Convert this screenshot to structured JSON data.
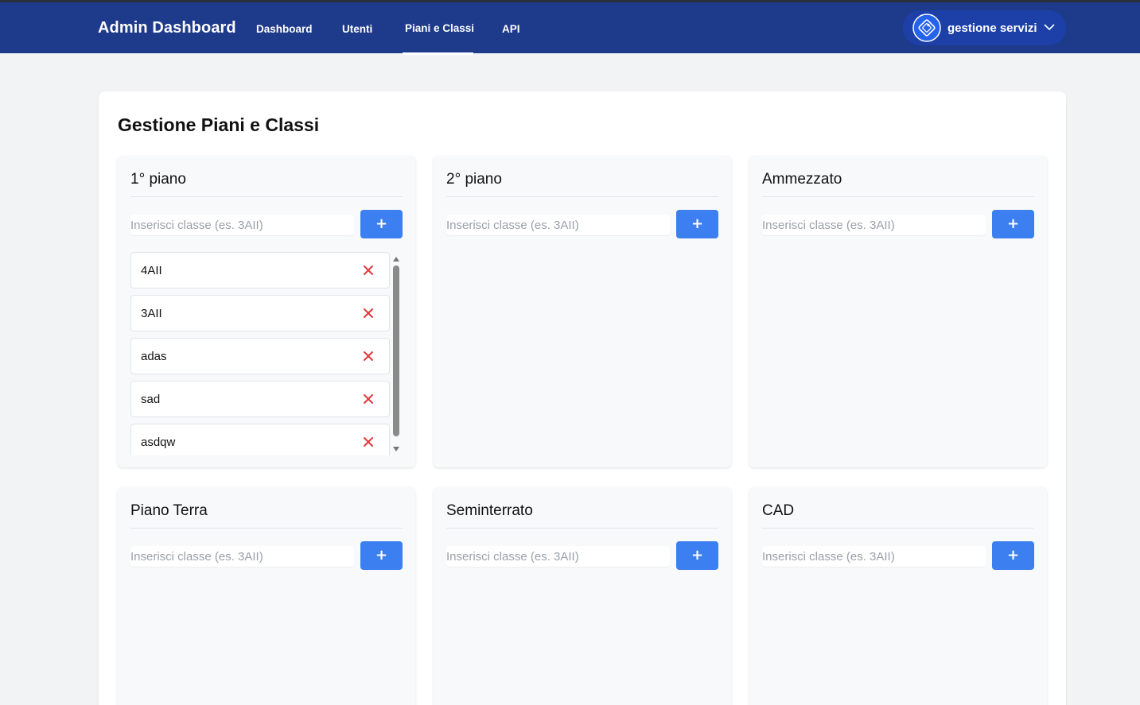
{
  "navbar": {
    "brand": "Admin Dashboard",
    "links": [
      {
        "label": "Dashboard"
      },
      {
        "label": "Utenti"
      },
      {
        "label": "Piani e Classi"
      },
      {
        "label": "API"
      }
    ],
    "active_link": "Piani e Classi",
    "user": {
      "label": "gestione servizi",
      "icon": "service-badge-icon"
    }
  },
  "main": {
    "title": "Gestione Piani e Classi",
    "input_placeholder": "Inserisci classe (es. 3AII)",
    "add_label": "+",
    "floors": [
      {
        "name": "1° piano",
        "classes": [
          "4AII",
          "3AII",
          "adas",
          "sad",
          "asdqw"
        ]
      },
      {
        "name": "2° piano",
        "classes": []
      },
      {
        "name": "Ammezzato",
        "classes": []
      },
      {
        "name": "Piano Terra",
        "classes": []
      },
      {
        "name": "Seminterrato",
        "classes": []
      },
      {
        "name": "CAD",
        "classes": []
      }
    ]
  },
  "colors": {
    "navbar": "#1e3a8a",
    "accent": "#3b7ff0",
    "delete": "#e0393e"
  }
}
